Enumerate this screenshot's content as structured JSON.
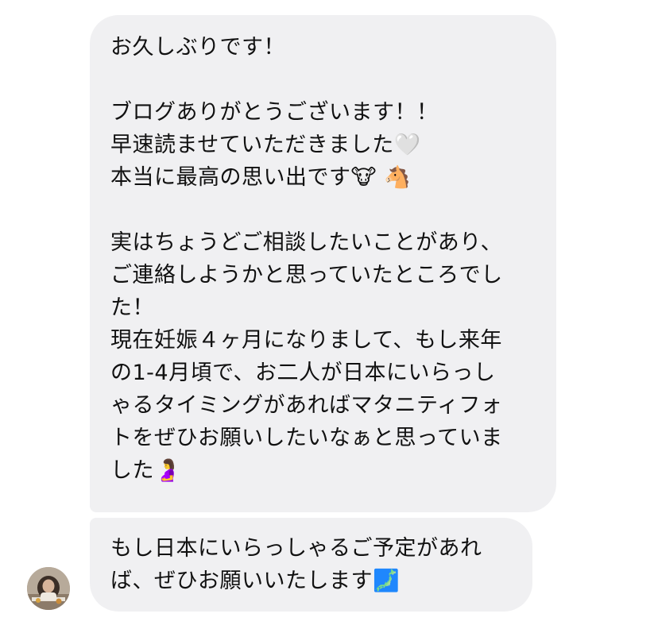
{
  "messages": [
    {
      "lines": [
        "お久しぶりです！",
        "",
        "ブログありがとうございます！！",
        "早速読ませていただきました🤍",
        "本当に最高の思い出です🐮 🐴",
        "",
        "実はちょうどご相談したいことがあり、",
        "ご連絡しようかと思っていたところでし",
        "た！",
        "現在妊娠４ヶ月になりまして、もし来年",
        "の1-4月頃で、お二人が日本にいらっし",
        "ゃるタイミングがあればマタニティフォ",
        "トをぜひお願いしたいなぁと思っていま",
        "した🤰"
      ]
    },
    {
      "lines": [
        "もし日本にいらっしゃるご予定があれ",
        "ば、ぜひお願いいたします🗾"
      ]
    }
  ],
  "colors": {
    "bubble": "#f0f0f2",
    "text": "#111111",
    "background": "#ffffff"
  },
  "avatar": {
    "icon": "person-photo-avatar"
  }
}
